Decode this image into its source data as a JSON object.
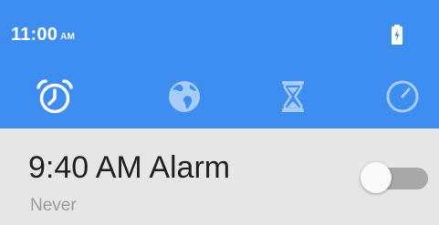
{
  "status_bar": {
    "time": "11:00",
    "ampm": "AM",
    "battery_icon": "battery-charging-icon"
  },
  "tabs": [
    {
      "name": "alarm",
      "icon": "alarm-clock-icon",
      "selected": true
    },
    {
      "name": "world-clock",
      "icon": "globe-icon",
      "selected": false
    },
    {
      "name": "timer",
      "icon": "hourglass-icon",
      "selected": false
    },
    {
      "name": "stopwatch",
      "icon": "stopwatch-icon",
      "selected": false
    }
  ],
  "alarm": {
    "time_label": "9:40 AM Alarm",
    "repeat_label": "Never",
    "enabled": false
  },
  "colors": {
    "accent": "#3d8ef0",
    "list_background": "#e6e6e6",
    "toggle_track_off": "#a8a8a8"
  }
}
